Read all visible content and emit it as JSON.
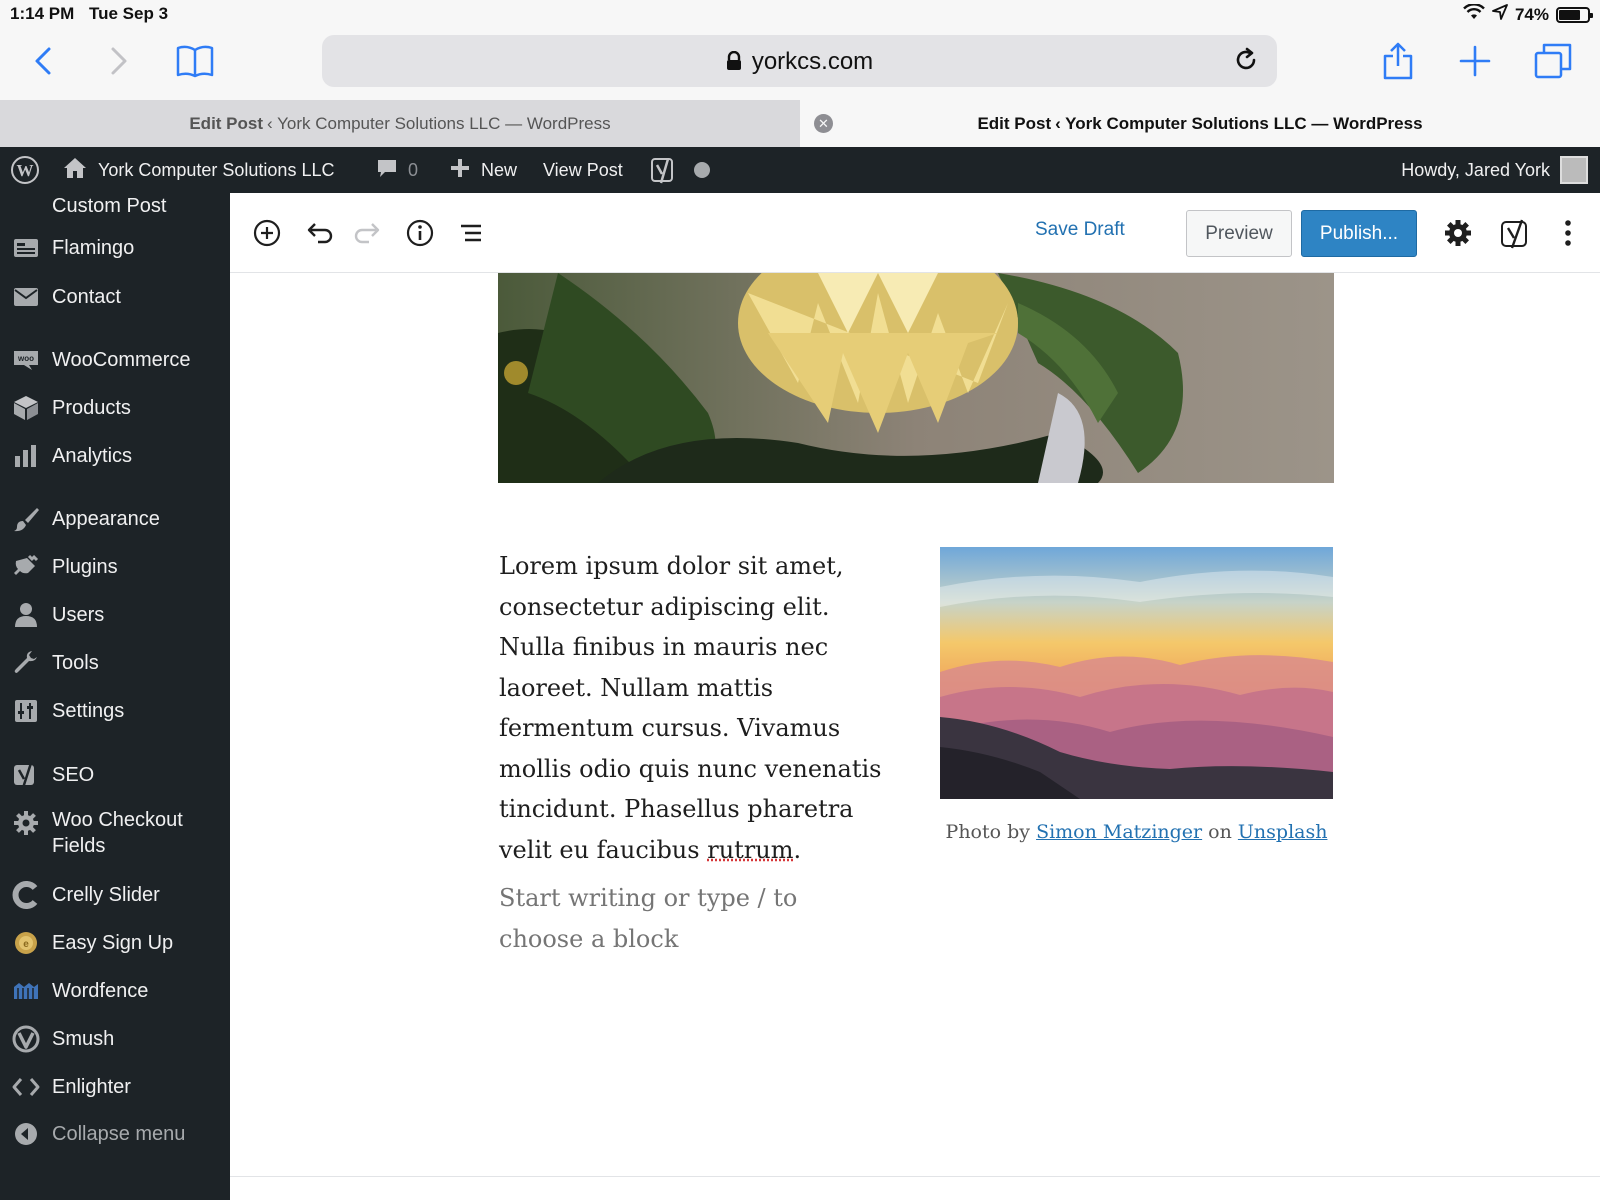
{
  "status_bar": {
    "time": "1:14 PM",
    "date": "Tue Sep 3",
    "battery": "74%",
    "battery_level": 0.74
  },
  "browser": {
    "url": "yorkcs.com",
    "tabs": [
      {
        "bold": "Edit Post",
        "rest": "‹ York Computer Solutions LLC — WordPress",
        "active": false
      },
      {
        "bold": "Edit Post",
        "rest": "‹ York Computer Solutions LLC — WordPress",
        "active": true
      }
    ]
  },
  "admin_bar": {
    "site_name": "York Computer Solutions LLC",
    "comments_count": "0",
    "new_label": "New",
    "view_post_label": "View Post",
    "howdy": "Howdy, Jared York"
  },
  "sidebar": {
    "items": [
      {
        "label": "Custom Post",
        "icon": "none"
      },
      {
        "label": "Flamingo",
        "icon": "flamingo-icon"
      },
      {
        "label": "Contact",
        "icon": "mail-icon"
      },
      {
        "label": "WooCommerce",
        "icon": "woo-icon"
      },
      {
        "label": "Products",
        "icon": "box-icon"
      },
      {
        "label": "Analytics",
        "icon": "bar-chart-icon"
      },
      {
        "label": "Appearance",
        "icon": "brush-icon"
      },
      {
        "label": "Plugins",
        "icon": "plug-icon"
      },
      {
        "label": "Users",
        "icon": "user-icon"
      },
      {
        "label": "Tools",
        "icon": "wrench-icon"
      },
      {
        "label": "Settings",
        "icon": "sliders-icon"
      },
      {
        "label": "SEO",
        "icon": "yoast-icon"
      },
      {
        "label": "Woo Checkout\nFields",
        "icon": "gear-icon"
      },
      {
        "label": "Crelly Slider",
        "icon": "crelly-icon"
      },
      {
        "label": "Easy Sign Up",
        "icon": "coin-icon"
      },
      {
        "label": "Wordfence",
        "icon": "wordfence-icon"
      },
      {
        "label": "Smush",
        "icon": "smush-icon"
      },
      {
        "label": "Enlighter",
        "icon": "code-icon"
      }
    ],
    "collapse_label": "Collapse menu"
  },
  "editor_toolbar": {
    "save_draft": "Save Draft",
    "preview": "Preview",
    "publish": "Publish..."
  },
  "content": {
    "paragraph_main": "Lorem ipsum dolor sit amet, consectetur adipiscing elit. Nulla finibus in mauris nec laoreet. Nullam mattis fermentum cursus. Vivamus mollis odio quis nunc venenatis tincidunt. Phasellus pharetra velit eu faucibus ",
    "paragraph_spell": "rutrum",
    "paragraph_end": ".",
    "placeholder": "Start writing or type / to choose a block",
    "caption_prefix": "Photo by",
    "caption_author": "Simon Matzinger",
    "caption_mid": "on",
    "caption_site": "Unsplash"
  },
  "colors": {
    "admin_dark": "#1d2327",
    "accent_blue": "#2271b1",
    "publish_blue": "#2e84c4",
    "ios_blue": "#2f7cf6"
  }
}
